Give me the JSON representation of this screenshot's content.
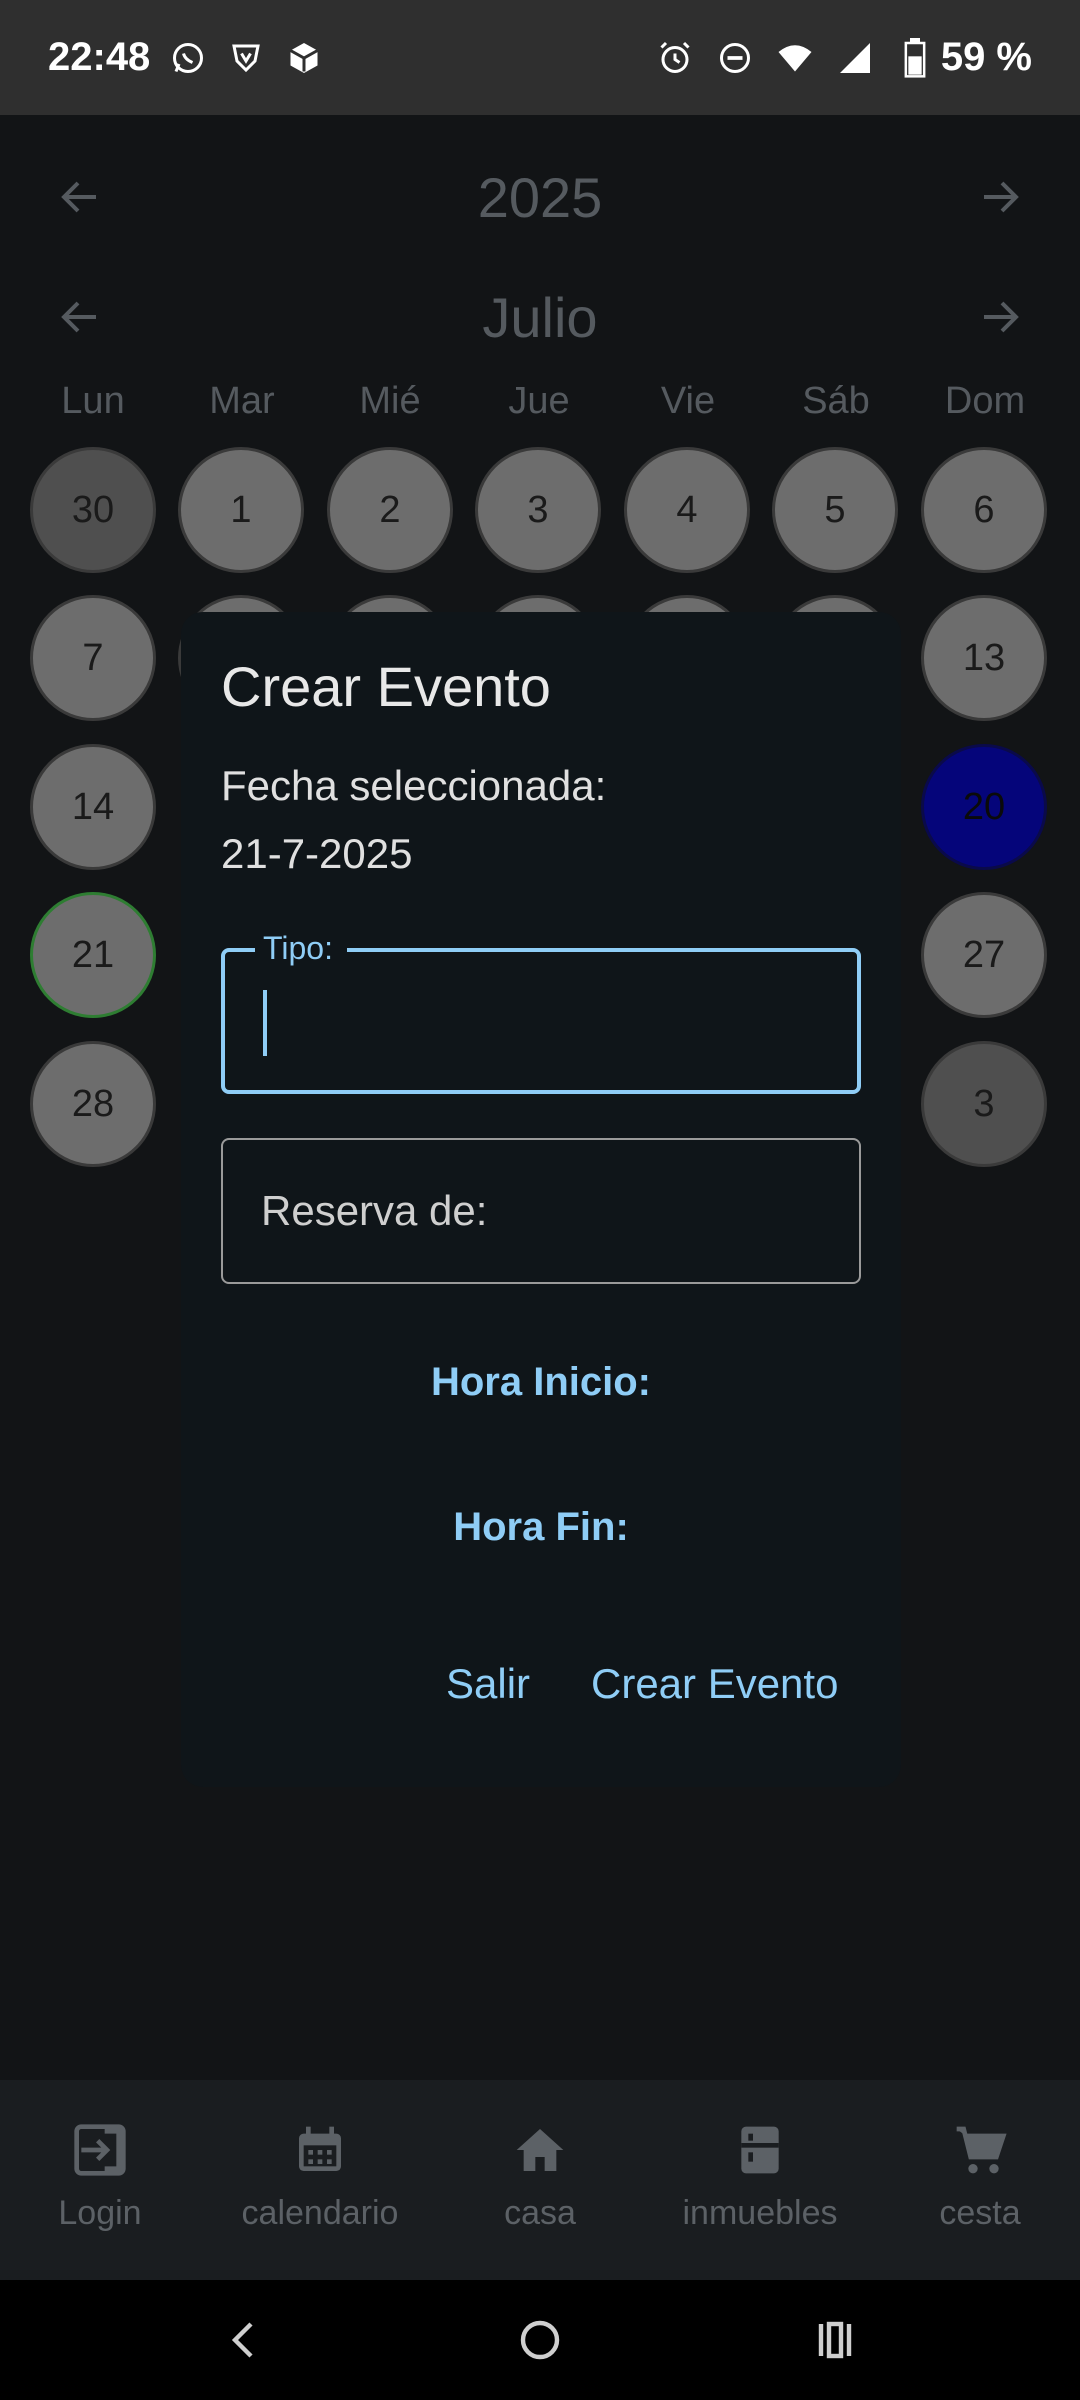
{
  "status_bar": {
    "time": "22:48",
    "battery": "59 %",
    "left_icons": [
      "whatsapp-icon",
      "shield-icon",
      "cube-icon"
    ],
    "right_icons": [
      "alarm-icon",
      "do-not-disturb-icon",
      "wifi-icon",
      "signal-icon",
      "battery-icon"
    ]
  },
  "calendar": {
    "year": "2025",
    "month": "Julio",
    "weekdays": [
      "Lun",
      "Mar",
      "Mié",
      "Jue",
      "Vie",
      "Sáb",
      "Dom"
    ],
    "row1": [
      "30",
      "1",
      "2",
      "3",
      "4",
      "5",
      "6"
    ],
    "visible_left_column": [
      "7",
      "14",
      "21",
      "28"
    ],
    "visible_right_column": [
      "13",
      "20",
      "27",
      "3"
    ],
    "today": "21",
    "selected": "20"
  },
  "dialog": {
    "title": "Crear Evento",
    "date_label_line1": "Fecha seleccionada:",
    "date_label_line2": "21-7-2025",
    "tipo_label": "Tipo:",
    "tipo_value": "",
    "reserva_placeholder": "Reserva de:",
    "hora_inicio": "Hora Inicio:",
    "hora_fin": "Hora Fin:",
    "cancel": "Salir",
    "confirm": "Crear Evento"
  },
  "bottom_nav": [
    {
      "label": "Login",
      "icon": "login-icon"
    },
    {
      "label": "calendario",
      "icon": "calendar-icon"
    },
    {
      "label": "casa",
      "icon": "home-icon"
    },
    {
      "label": "inmuebles",
      "icon": "cabinet-icon"
    },
    {
      "label": "cesta",
      "icon": "cart-icon"
    }
  ],
  "colors": {
    "accent": "#8fcdf6",
    "today_border": "#2e7d32",
    "selected_day": "#05057a"
  }
}
